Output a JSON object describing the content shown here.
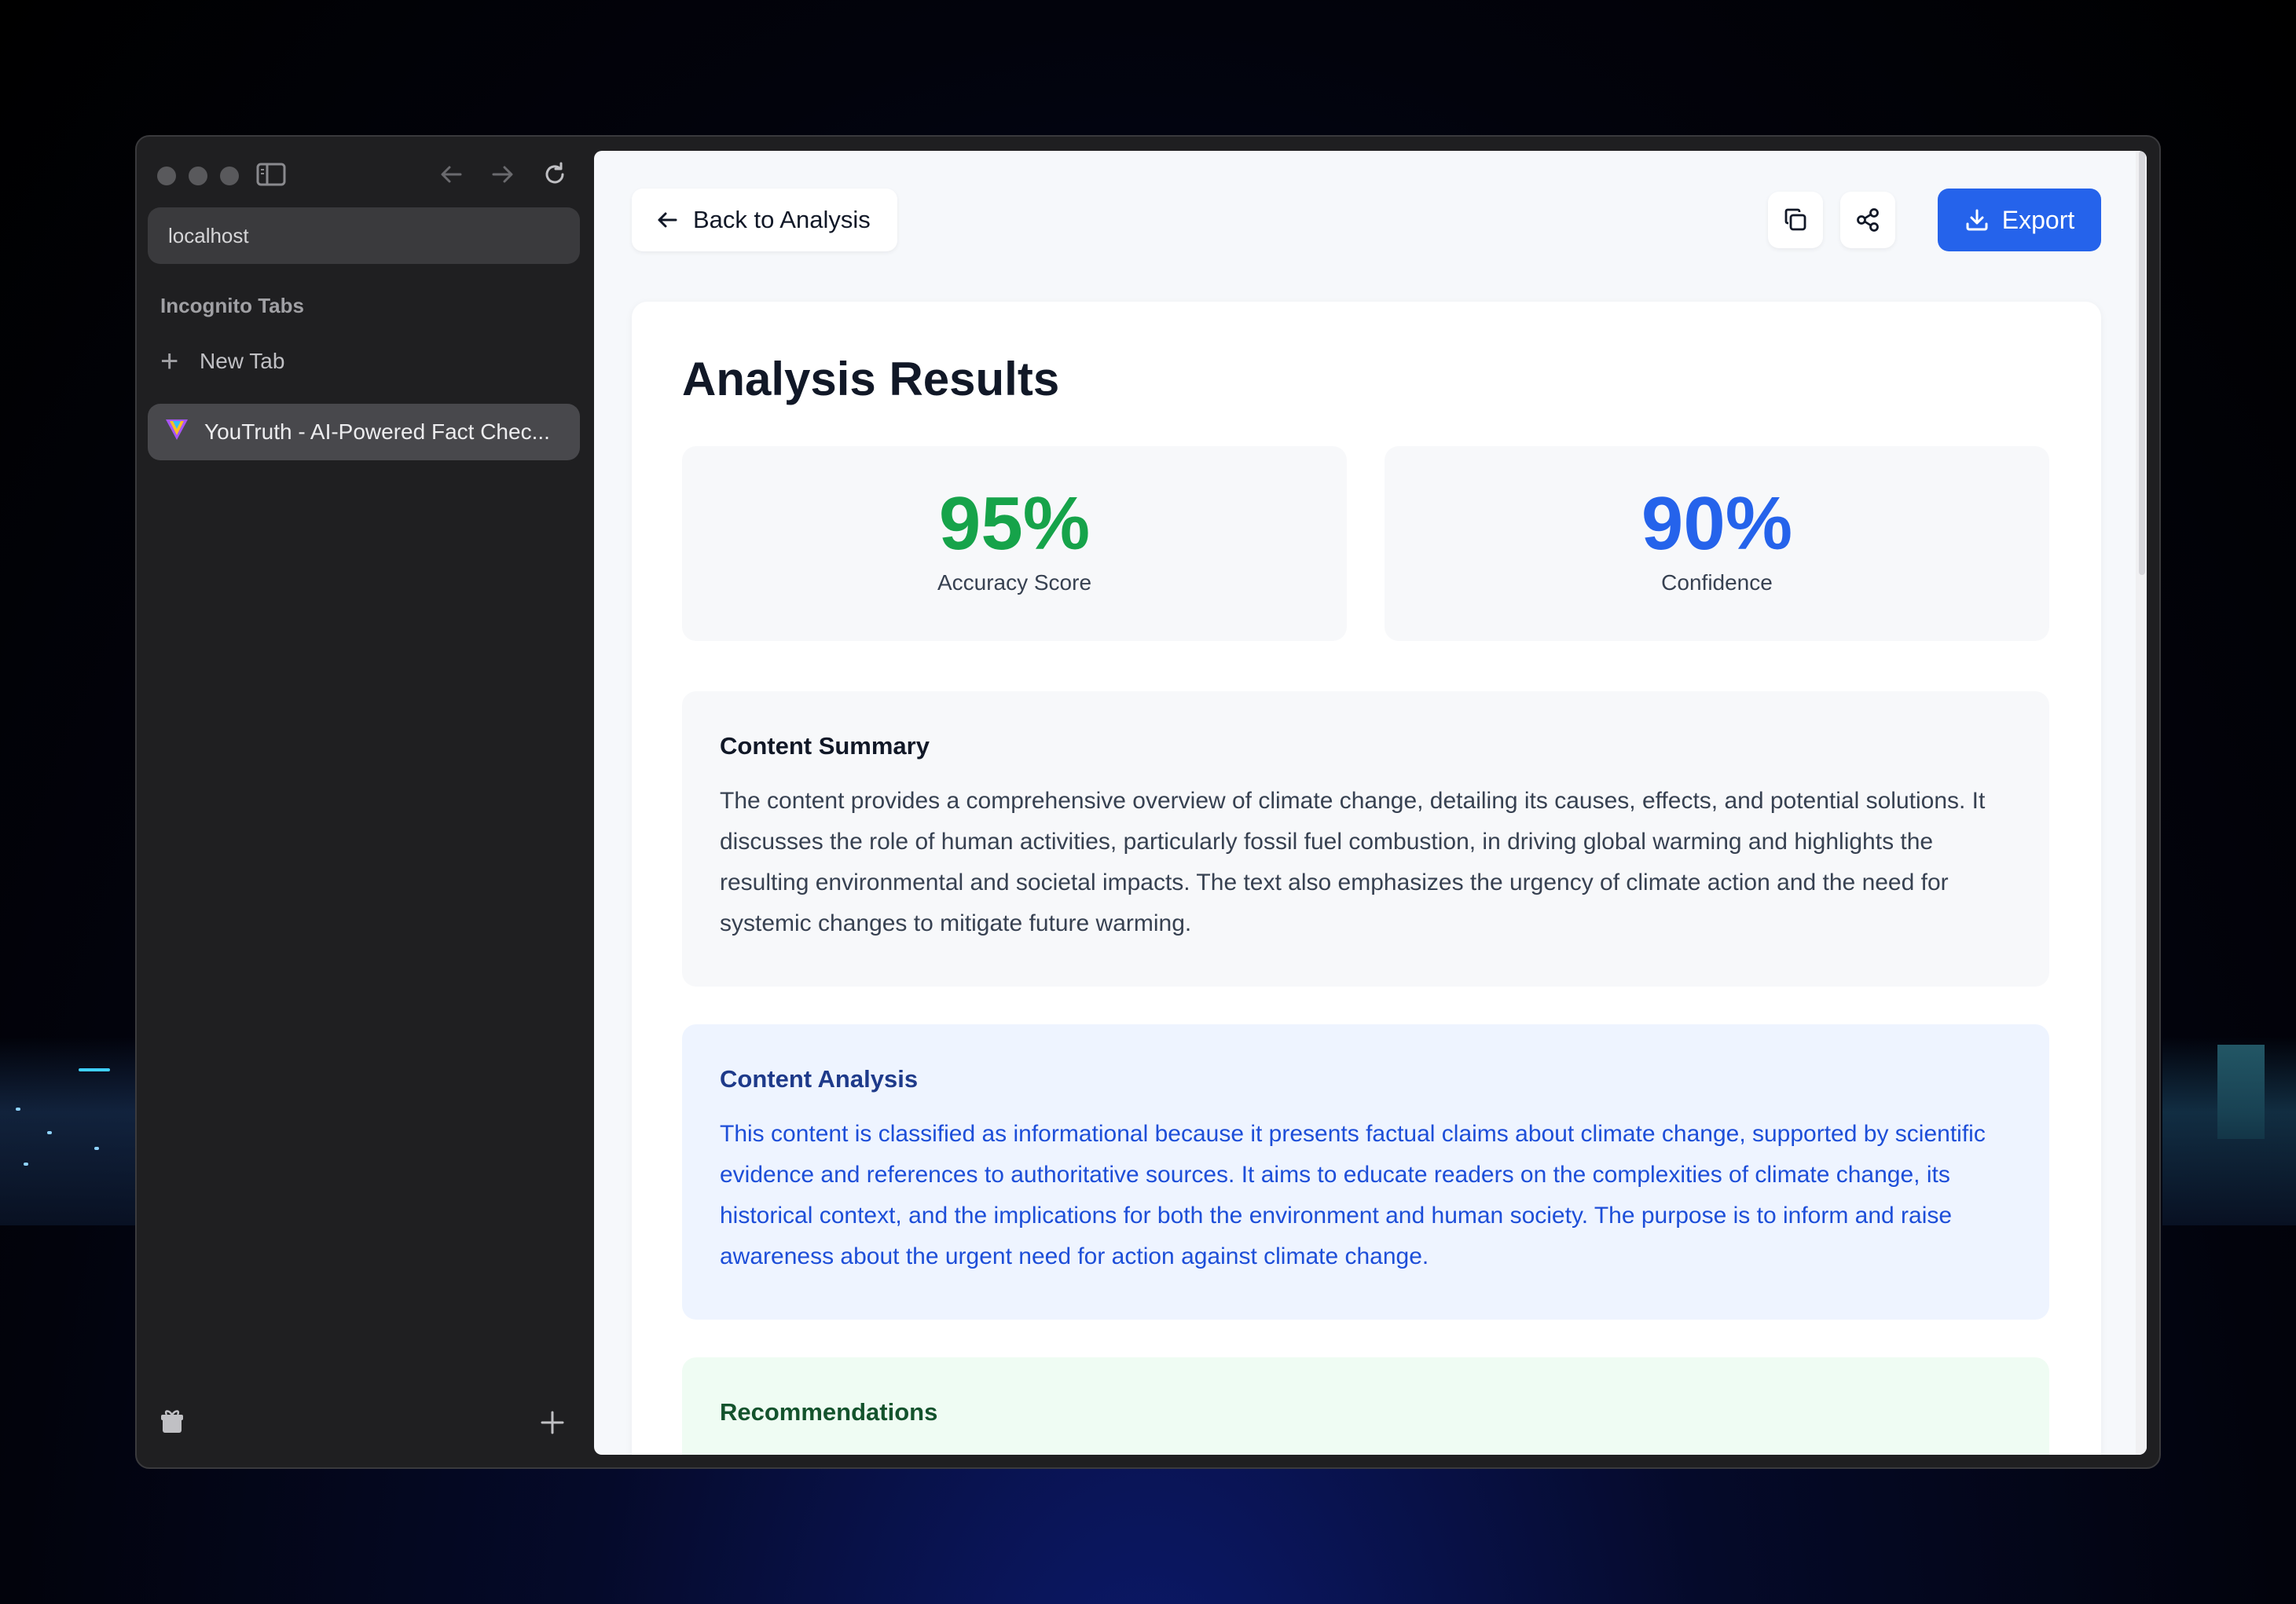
{
  "browser": {
    "address": "localhost",
    "section_label": "Incognito Tabs",
    "new_tab_label": "New Tab",
    "active_tab_title": "YouTruth - AI-Powered Fact Chec..."
  },
  "toolbar": {
    "back_label": "Back to Analysis",
    "export_label": "Export"
  },
  "results": {
    "title": "Analysis Results",
    "accuracy": {
      "value": "95%",
      "label": "Accuracy Score",
      "color": "#16a34a"
    },
    "confidence": {
      "value": "90%",
      "label": "Confidence",
      "color": "#2563eb"
    }
  },
  "summary": {
    "heading": "Content Summary",
    "text": "The content provides a comprehensive overview of climate change, detailing its causes, effects, and potential solutions. It discusses the role of human activities, particularly fossil fuel combustion, in driving global warming and highlights the resulting environmental and societal impacts. The text also emphasizes the urgency of climate action and the need for systemic changes to mitigate future warming."
  },
  "analysis": {
    "heading": "Content Analysis",
    "text": "This content is classified as informational because it presents factual claims about climate change, supported by scientific evidence and references to authoritative sources. It aims to educate readers on the complexities of climate change, its historical context, and the implications for both the environment and human society. The purpose is to inform and raise awareness about the urgent need for action against climate change."
  },
  "recommendations": {
    "heading": "Recommendations"
  },
  "colors": {
    "accent": "#2563eb",
    "success": "#16a34a"
  }
}
